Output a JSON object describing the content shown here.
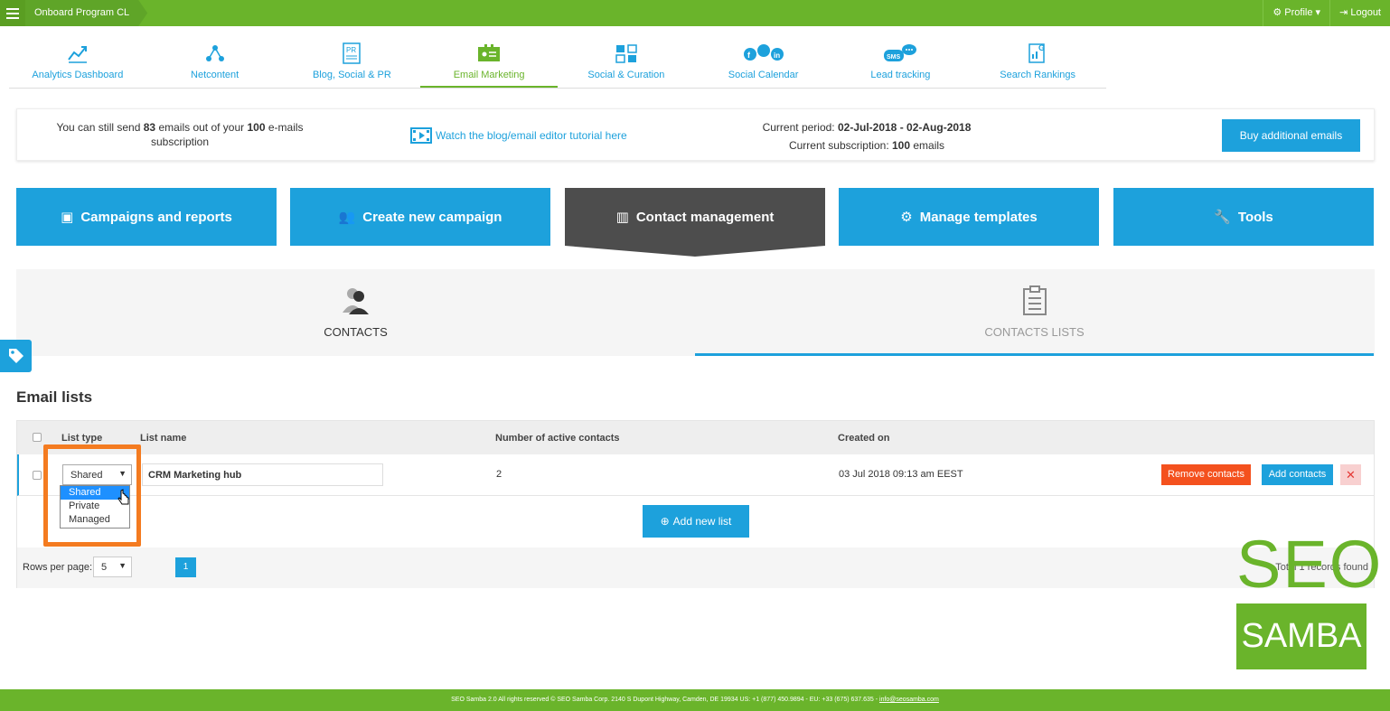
{
  "topbar": {
    "program": "Onboard Program CL",
    "profile": "Profile",
    "logout": "Logout"
  },
  "nav": [
    {
      "label": "Analytics Dashboard",
      "icon": "chart-line-icon"
    },
    {
      "label": "Netcontent",
      "icon": "network-icon"
    },
    {
      "label": "Blog, Social & PR",
      "icon": "pr-document-icon"
    },
    {
      "label": "Email Marketing",
      "icon": "email-marketing-icon",
      "active": true
    },
    {
      "label": "Social & Curation",
      "icon": "social-curation-icon"
    },
    {
      "label": "Social Calendar",
      "icon": "social-calendar-icon"
    },
    {
      "label": "Lead tracking",
      "icon": "sms-icon"
    },
    {
      "label": "Search Rankings",
      "icon": "search-rankings-icon"
    }
  ],
  "info": {
    "send_prefix": "You can still send",
    "remaining": "83",
    "send_mid": "emails out of your",
    "total": "100",
    "send_suffix": "e-mails subscription",
    "tutorial": "Watch the blog/email editor tutorial here",
    "period_label": "Current period:",
    "period_value": "02-Jul-2018 - 02-Aug-2018",
    "subscription_label": "Current subscription:",
    "subscription_value": "100",
    "subscription_unit": "emails",
    "buy": "Buy additional emails"
  },
  "tiles": [
    {
      "label": "Campaigns and reports",
      "icon": "briefcase-icon"
    },
    {
      "label": "Create new campaign",
      "icon": "users-icon"
    },
    {
      "label": "Contact management",
      "icon": "address-book-icon",
      "active": true
    },
    {
      "label": "Manage templates",
      "icon": "gear-icon"
    },
    {
      "label": "Tools",
      "icon": "wrench-icon"
    }
  ],
  "subtabs": [
    {
      "label": "CONTACTS",
      "icon": "contacts-icon"
    },
    {
      "label": "CONTACTS LISTS",
      "icon": "clipboard-icon",
      "active": true
    }
  ],
  "section_title": "Email lists",
  "table": {
    "headers": [
      "List type",
      "List name",
      "Number of active contacts",
      "Created on"
    ],
    "rows": [
      {
        "type": "Shared",
        "name": "CRM Marketing hub",
        "contacts": "2",
        "created": "03 Jul 2018 09:13 am EEST"
      }
    ],
    "remove_btn": "Remove contacts",
    "add_btn": "Add contacts",
    "delete_btn": "✕",
    "add_list": "Add new list",
    "rows_per_page_label": "Rows per page:",
    "rows_per_page": "5",
    "page": "1",
    "total_text": "Total 1 records found"
  },
  "dropdown": {
    "options": [
      "Shared",
      "Private",
      "Managed"
    ],
    "selected": "Shared"
  },
  "logo": {
    "line1": "SEO",
    "line2": "SAMBA"
  },
  "footer": {
    "text": "SEO Samba 2.0  All rights reserved © SEO Samba Corp. 2140 S Dupont Highway, Camden, DE 19934 US: +1 (877) 450.9894 - EU: +33 (675) 637.635 - ",
    "email": "info@seosamba.com"
  },
  "colors": {
    "green": "#6ab42b",
    "blue": "#1da1dc",
    "dark": "#4d4d4d",
    "orange": "#f47b20",
    "red": "#f4511e"
  }
}
